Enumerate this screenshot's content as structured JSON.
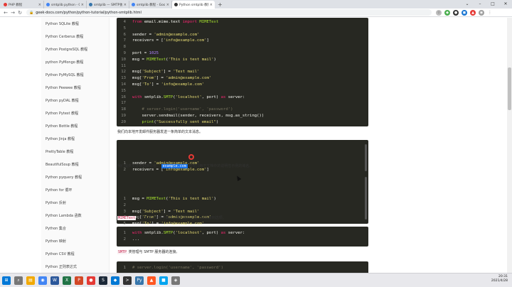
{
  "browser": {
    "tabs": [
      {
        "title": "PHP 教程",
        "color": "#e53935",
        "active": false
      },
      {
        "title": "smtplib python - Google 搜索",
        "color": "#4285f4",
        "active": false
      },
      {
        "title": "smtplib — SMTP协议客户端 — ...",
        "color": "#3776ab",
        "active": false
      },
      {
        "title": "smtplib 教程 - Google 搜索",
        "color": "#4285f4",
        "active": false
      },
      {
        "title": "Python smtplib 教程发送邮件",
        "color": "#333333",
        "active": true
      }
    ],
    "new_tab": "+",
    "url": "geek-docs.com/python/python-tutorial/python-smtplib.html"
  },
  "sidebar": {
    "items": [
      "Python SQLite 教程",
      "Python Cerberus 教程",
      "Python PostgreSQL 教程",
      "python PyMongo 教程",
      "Python PyMySQL 教程",
      "Python Peewee 教程",
      "Python pyDAL 教程",
      "Python Pytest 教程",
      "Python Bottle 教程",
      "Python Jinja 教程",
      "PrettyTable 教程",
      "BeautifulSoup 教程",
      "Python pyquery 教程",
      "Python for 循环",
      "Python 反射",
      "Python Lambda 函数",
      "Python 集合",
      "Python 映射",
      "Python CSV 教程",
      "Python 正则表达式"
    ]
  },
  "code1": {
    "lines": [
      {
        "n": "4",
        "t": "from email.mime.text import MIMEText"
      },
      {
        "n": "5",
        "t": ""
      },
      {
        "n": "6",
        "t": "sender = 'admin@example.com'"
      },
      {
        "n": "7",
        "t": "receivers = ['info@example.com']"
      },
      {
        "n": "8",
        "t": ""
      },
      {
        "n": "9",
        "t": "port = 1025"
      },
      {
        "n": "10",
        "t": "msg = MIMEText('This is test mail')"
      },
      {
        "n": "11",
        "t": ""
      },
      {
        "n": "12",
        "t": "msg['Subject'] = 'Test mail'"
      },
      {
        "n": "13",
        "t": "msg['From'] = 'admin@example.com'"
      },
      {
        "n": "14",
        "t": "msg['To'] = 'info@example.com'"
      },
      {
        "n": "15",
        "t": ""
      },
      {
        "n": "16",
        "t": "with smtplib.SMTP('localhost', port) as server:"
      },
      {
        "n": "17",
        "t": ""
      },
      {
        "n": "18",
        "t": "    # server.login('username', 'password')"
      },
      {
        "n": "19",
        "t": "    server.sendmail(sender, receivers, msg.as_string())"
      },
      {
        "n": "20",
        "t": "    print(\"Successfully sent email\")"
      }
    ]
  },
  "text1": "我们向本地开发邮件服务器发送一条简单的文本消息。",
  "code2": {
    "lines": [
      {
        "n": "1",
        "t": "sender = 'admin@example.com'"
      },
      {
        "n": "2",
        "t": "receivers = ['info@example.com']"
      }
    ]
  },
  "text2": {
    "before": "我们提供发送者和接收者。",
    "highlight": "example.com",
    "after": "是专门用于文档中的说明性示例的域名。"
  },
  "code3": {
    "lines": [
      {
        "n": "1",
        "t": "msg = MIMEText('This is test mail')"
      },
      {
        "n": "2",
        "t": ""
      },
      {
        "n": "3",
        "t": "msg['Subject'] = 'Test mail'"
      },
      {
        "n": "4",
        "t": "msg['From'] = 'admin@example.com'"
      },
      {
        "n": "5",
        "t": "msg['To'] = 'info@example.com'"
      }
    ]
  },
  "text3": {
    "code": "MIMEText",
    "after": "用于发送文本电子邮件。我们提供主题、从项目到选项。"
  },
  "code4": {
    "lines": [
      {
        "n": "1",
        "t": "with smtplib.SMTP('localhost', port) as server:"
      },
      {
        "n": "2",
        "t": "..."
      }
    ]
  },
  "text4": {
    "code": "SMTP",
    "after": "类管理与 SMTP 服务器的连接。"
  },
  "code5": {
    "lines": [
      {
        "n": "1",
        "t": "# server.login('username', 'password')"
      }
    ]
  },
  "taskbar": {
    "time": "20:31",
    "date": "2021/4/28"
  }
}
